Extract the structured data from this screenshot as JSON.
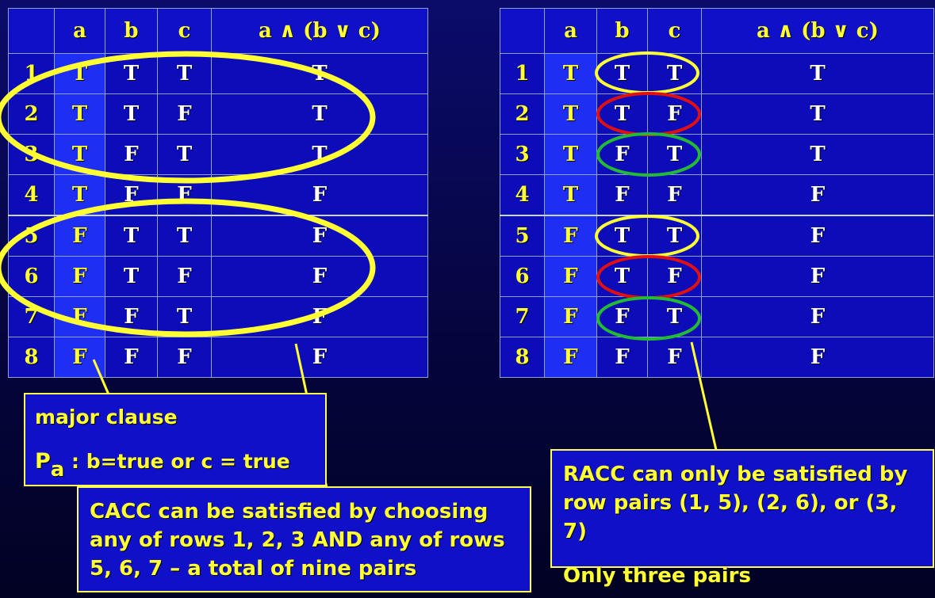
{
  "left_table": {
    "headers": [
      "",
      "a",
      "b",
      "c",
      "a ∧ (b ∨ c)"
    ],
    "rows": [
      [
        "1",
        "T",
        "T",
        "T",
        "T"
      ],
      [
        "2",
        "T",
        "T",
        "F",
        "T"
      ],
      [
        "3",
        "T",
        "F",
        "T",
        "T"
      ],
      [
        "4",
        "T",
        "F",
        "F",
        "F"
      ],
      [
        "5",
        "F",
        "T",
        "T",
        "F"
      ],
      [
        "6",
        "F",
        "T",
        "F",
        "F"
      ],
      [
        "7",
        "F",
        "F",
        "T",
        "F"
      ],
      [
        "8",
        "F",
        "F",
        "F",
        "F"
      ]
    ]
  },
  "right_table": {
    "headers": [
      "",
      "a",
      "b",
      "c",
      "a ∧ (b ∨ c)"
    ],
    "rows": [
      [
        "1",
        "T",
        "T",
        "T",
        "T"
      ],
      [
        "2",
        "T",
        "T",
        "F",
        "T"
      ],
      [
        "3",
        "T",
        "F",
        "T",
        "T"
      ],
      [
        "4",
        "T",
        "F",
        "F",
        "F"
      ],
      [
        "5",
        "F",
        "T",
        "T",
        "F"
      ],
      [
        "6",
        "F",
        "T",
        "F",
        "F"
      ],
      [
        "7",
        "F",
        "F",
        "T",
        "F"
      ],
      [
        "8",
        "F",
        "F",
        "F",
        "F"
      ]
    ]
  },
  "major_clause": {
    "line1": "major clause",
    "p": "P",
    "p_sub": "a",
    "line2": " : b=true or c = true"
  },
  "cacc": {
    "line1": "CACC can be satisfied by choosing",
    "line2": "any of rows 1, 2, 3 AND any of rows",
    "line3": "5, 6, 7 – a total of nine pairs"
  },
  "racc": {
    "line1": "RACC can only be satisfied by",
    "line2": "row pairs (1, 5), (2, 6), or (3, 7)",
    "line3": "Only three pairs"
  },
  "colors": {
    "background": "#05053f",
    "cell": "#0c0cb9",
    "a_column": "#1f2ef3",
    "highlight_yellow": "#ffff33",
    "ellipse_red": "#e01010",
    "ellipse_green": "#22bb33"
  }
}
